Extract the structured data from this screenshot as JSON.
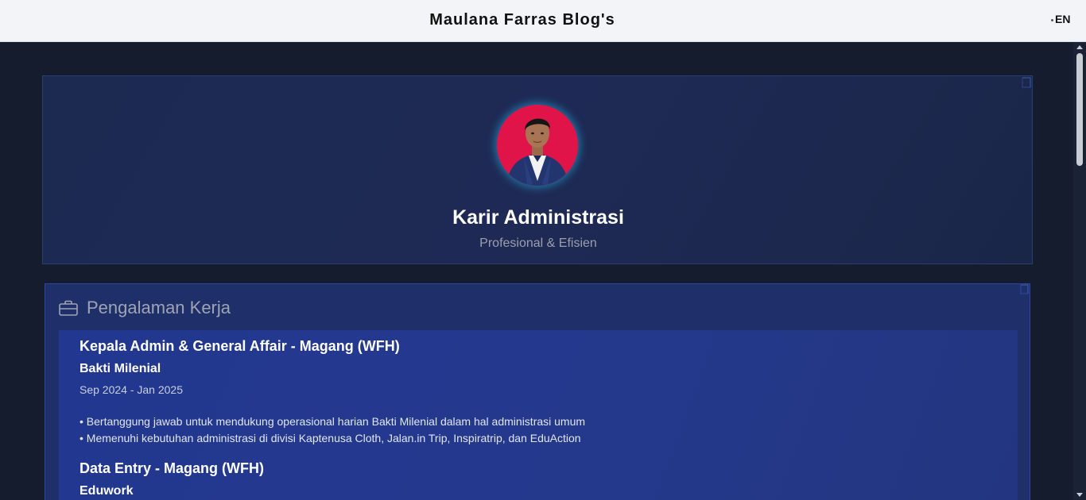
{
  "header": {
    "title": "Maulana Farras Blog's",
    "language": "EN"
  },
  "hero": {
    "title": "Karir Administrasi",
    "subtitle": "Profesional & Efisien",
    "avatar_bg": "#e1144a",
    "glow_color": "#26aadc"
  },
  "experience": {
    "heading": "Pengalaman Kerja",
    "icon": "briefcase-icon",
    "jobs": [
      {
        "title": "Kepala Admin & General Affair - Magang (WFH)",
        "company": "Bakti Milenial",
        "period": "Sep 2024 - Jan 2025",
        "bullets": [
          "• Bertanggung jawab untuk mendukung operasional harian Bakti Milenial dalam hal administrasi umum",
          "• Memenuhi kebutuhan administrasi di divisi Kaptenusa Cloth, Jalan.in Trip, Inspiratrip, dan EduAction"
        ]
      },
      {
        "title": "Data Entry - Magang (WFH)",
        "company": "Eduwork"
      }
    ]
  },
  "colors": {
    "page_bg": "#141c2e",
    "topbar_bg": "#f3f4f7",
    "panel_bg": "#1f2f6a",
    "card_bg": "#223890"
  }
}
